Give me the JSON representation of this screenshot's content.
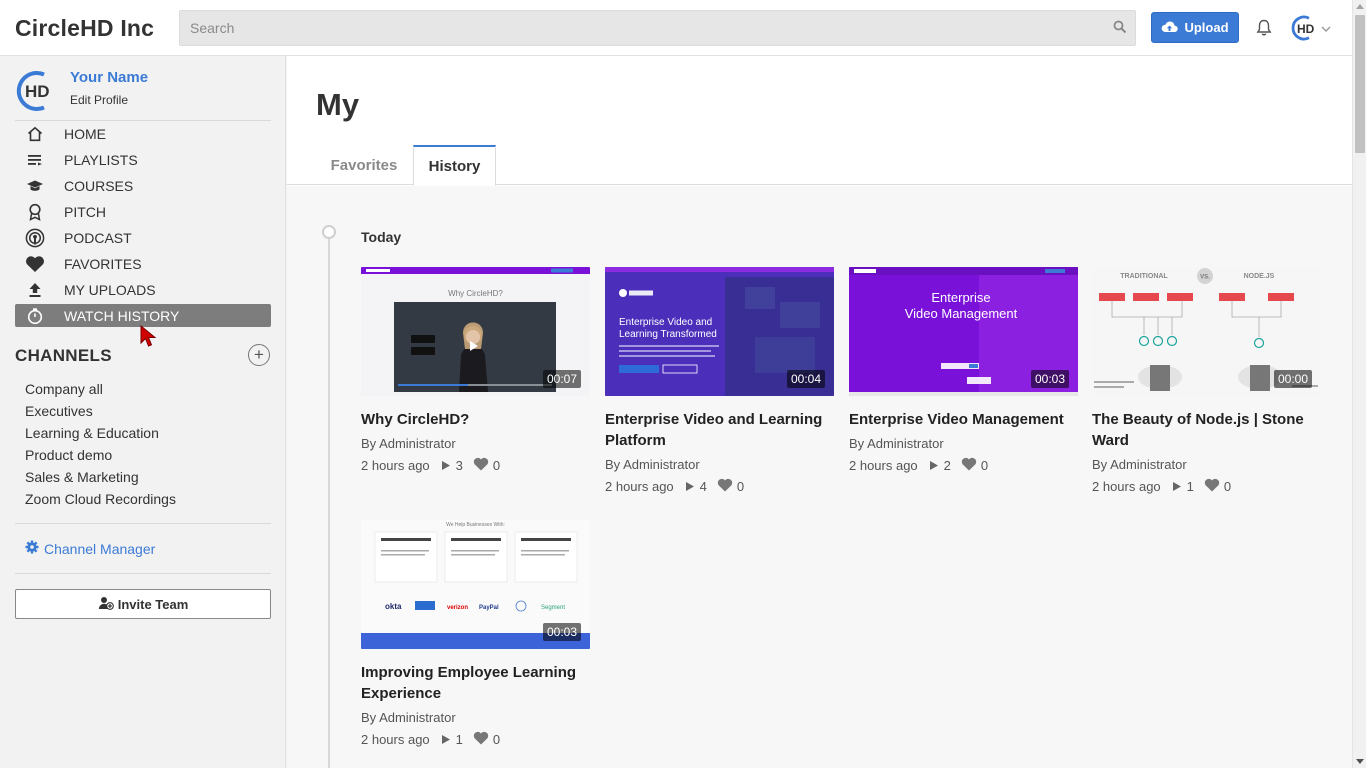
{
  "app": {
    "brand": "CircleHD Inc"
  },
  "header": {
    "search_placeholder": "Search",
    "upload_label": "Upload",
    "avatar_text": "HD"
  },
  "profile": {
    "name": "Your Name",
    "edit_label": "Edit Profile",
    "avatar_text": "HD"
  },
  "nav": [
    {
      "label": "HOME",
      "icon": "home-icon"
    },
    {
      "label": "PLAYLISTS",
      "icon": "playlist-icon"
    },
    {
      "label": "COURSES",
      "icon": "graduation-cap-icon"
    },
    {
      "label": "PITCH",
      "icon": "award-icon"
    },
    {
      "label": "PODCAST",
      "icon": "podcast-icon"
    },
    {
      "label": "FAVORITES",
      "icon": "heart-icon"
    },
    {
      "label": "MY UPLOADS",
      "icon": "upload-icon"
    },
    {
      "label": "WATCH HISTORY",
      "icon": "stopwatch-icon",
      "active": true
    }
  ],
  "channels": {
    "heading": "CHANNELS",
    "items": [
      "Company all",
      "Executives",
      "Learning & Education",
      "Product demo",
      "Sales & Marketing",
      "Zoom Cloud Recordings"
    ],
    "manager_label": "Channel Manager",
    "invite_label": "Invite Team"
  },
  "main": {
    "title": "My",
    "tabs": [
      {
        "label": "Favorites"
      },
      {
        "label": "History",
        "active": true
      }
    ],
    "day_label": "Today",
    "videos": [
      {
        "title": "Why CircleHD?",
        "by": "By Administrator",
        "ago": "2 hours ago",
        "plays": "3",
        "likes": "0",
        "duration": "00:07",
        "thumb_text": "Why CircleHD?"
      },
      {
        "title": "Enterprise Video and Learning Platform",
        "by": "By Administrator",
        "ago": "2 hours ago",
        "plays": "4",
        "likes": "0",
        "duration": "00:04",
        "thumb_text": "Enterprise Video and Learning Transformed"
      },
      {
        "title": "Enterprise Video Management",
        "by": "By Administrator",
        "ago": "2 hours ago",
        "plays": "2",
        "likes": "0",
        "duration": "00:03",
        "thumb_text": "Enterprise Video Management"
      },
      {
        "title": "The Beauty of Node.js | Stone Ward",
        "by": "By Administrator",
        "ago": "2 hours ago",
        "plays": "1",
        "likes": "0",
        "duration": "00:00",
        "thumb_text": "TRADITIONAL VS. NODE.JS"
      },
      {
        "title": "Improving Employee Learning Experience",
        "by": "By Administrator",
        "ago": "2 hours ago",
        "plays": "1",
        "likes": "0",
        "duration": "00:03",
        "thumb_text": "We Help Businesses With:"
      }
    ]
  },
  "colors": {
    "accent": "#3b7bd6",
    "active_nav": "#7d7d7d",
    "thumb_purple": "#7a11d9"
  }
}
